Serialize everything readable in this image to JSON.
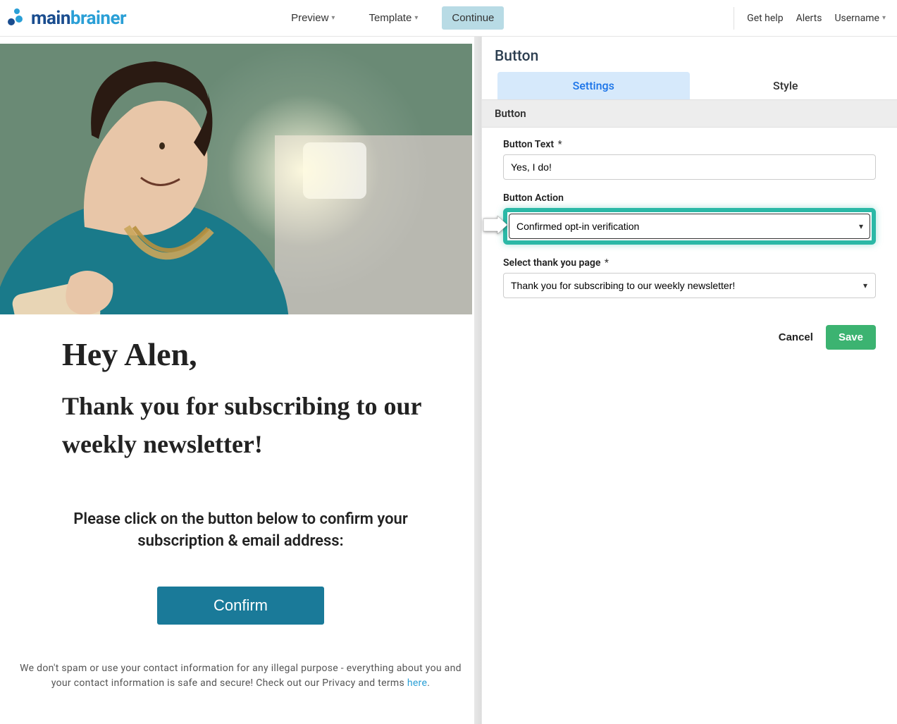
{
  "brand": {
    "main": "main",
    "sub": "brainer"
  },
  "topnav": {
    "preview": "Preview",
    "template": "Template",
    "continue": "Continue",
    "gethelp": "Get help",
    "alerts": "Alerts",
    "username": "Username"
  },
  "preview": {
    "greeting": "Hey Alen,",
    "thankyou": "Thank you for subscribing to our weekly newsletter!",
    "instruction": "Please click on the button below to confirm your subscription & email address:",
    "confirm": "Confirm",
    "footnote_a": "We don't spam or use your contact information for any illegal purpose - everything about you and your contact information is safe and secure! Check out our Privacy and terms ",
    "footnote_link": "here",
    "footnote_b": "."
  },
  "panel": {
    "title": "Button",
    "tabs": {
      "settings": "Settings",
      "style": "Style"
    },
    "section": "Button",
    "button_text_label": "Button Text",
    "button_text_value": "Yes, I do!",
    "button_action_label": "Button Action",
    "button_action_value": "Confirmed opt-in verification",
    "thankyou_label": "Select thank you page",
    "thankyou_value": "Thank you for subscribing to our weekly newsletter!",
    "cancel": "Cancel",
    "save": "Save"
  }
}
